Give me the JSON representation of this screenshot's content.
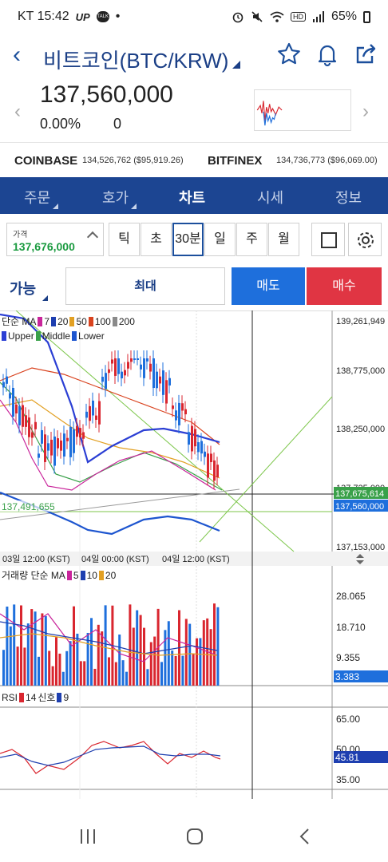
{
  "status_bar": {
    "carrier_time": "KT 15:42",
    "up_tag": "UP",
    "talk_tag": "TALK",
    "dot": "•",
    "hd": "HD",
    "battery": "65%"
  },
  "header": {
    "title": "비트코인(BTC/KRW)",
    "star_icon": "star-icon",
    "bell_icon": "bell-icon",
    "share_icon": "share-icon"
  },
  "ticker": {
    "price": "137,560,000",
    "change_pct": "0.00%",
    "change_value": "0"
  },
  "exchanges": [
    {
      "name": "COINBASE",
      "value": "134,526,762 ($95,919.26)"
    },
    {
      "name": "BITFINEX",
      "value": "134,736,773 ($96,069.00)"
    }
  ],
  "tabs": [
    {
      "label": "주문",
      "has_menu": true
    },
    {
      "label": "호가",
      "has_menu": true
    },
    {
      "label": "차트",
      "active": true
    },
    {
      "label": "시세"
    },
    {
      "label": "정보"
    }
  ],
  "controls": {
    "price_label": "가격",
    "price_value": "137,676,000",
    "intervals": [
      {
        "label": "틱"
      },
      {
        "label": "초"
      },
      {
        "label": "30분",
        "selected": true
      },
      {
        "label": "일"
      },
      {
        "label": "주"
      },
      {
        "label": "월"
      }
    ]
  },
  "order": {
    "available_label": "가능",
    "max_label": "최대",
    "sell_label": "매도",
    "buy_label": "매수"
  },
  "chart": {
    "price_legend": {
      "ma_label": "단순 MA",
      "ma_periods": [
        {
          "value": "7",
          "color": "#c9259b"
        },
        {
          "value": "20",
          "color": "#1e3fb0"
        },
        {
          "value": "50",
          "color": "#e2a023"
        },
        {
          "value": "100",
          "color": "#d9431f"
        },
        {
          "value": "200",
          "color": "#8a8a8a"
        }
      ],
      "bands": [
        {
          "label": "Upper",
          "color": "#2b3fd4"
        },
        {
          "label": "Middle",
          "color": "#3aa14a"
        },
        {
          "label": "Lower",
          "color": "#1d55cf"
        }
      ]
    },
    "price_axis": [
      "139,261,949",
      "138,775,000",
      "138,250,000",
      "137,725,000",
      "137,153,000"
    ],
    "price_tags": {
      "crosshair": "137,675,614",
      "current": "137,560,000"
    },
    "level_label": "137,491,655",
    "time_labels": [
      "03일 12:00 (KST)",
      "04일 00:00 (KST)",
      "04일 12:00 (KST)"
    ],
    "volume_legend": {
      "label": "거래량 단순 MA",
      "periods": [
        {
          "value": "5",
          "color": "#c9259b"
        },
        {
          "value": "10",
          "color": "#1e3fb0"
        },
        {
          "value": "20",
          "color": "#e2a023"
        }
      ]
    },
    "volume_axis": [
      "28.065",
      "18.710",
      "9.355"
    ],
    "volume_tag": "3.383",
    "rsi_legend": {
      "label": "RSI",
      "period": "14",
      "signal_label": "신호",
      "signal_period": "9",
      "rsi_color": "#d9262f",
      "signal_color": "#1e3fb0"
    },
    "rsi_axis": [
      "65.00",
      "50.00",
      "35.00"
    ],
    "rsi_tag": "45.81"
  },
  "colors": {
    "brand": "#1c4592",
    "up": "#d9262f",
    "down": "#1e6fdc",
    "sell": "#1e6fdc",
    "buy": "#e03543"
  }
}
